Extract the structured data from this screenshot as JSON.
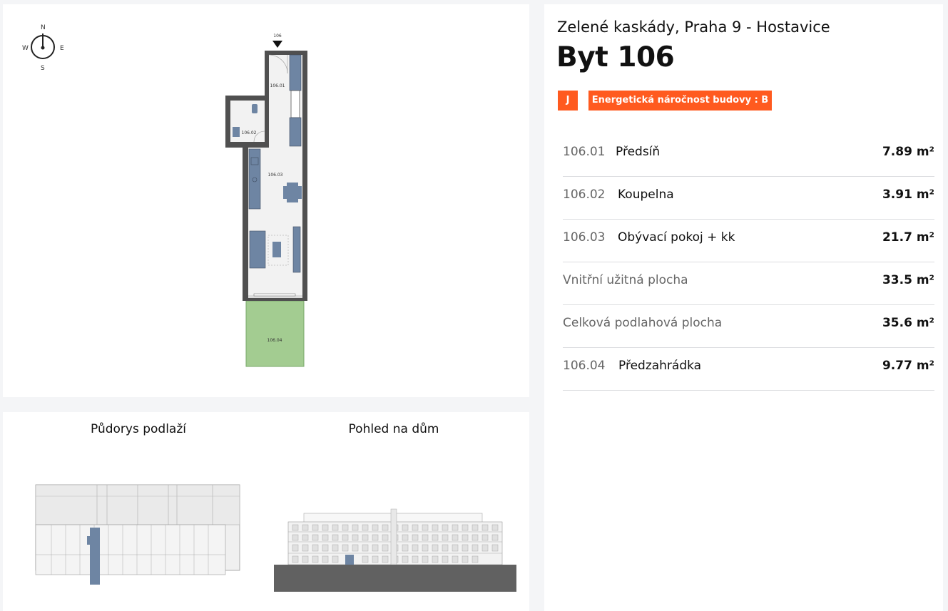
{
  "floorplan": {
    "compass": {
      "n": "N",
      "s": "S",
      "w": "W",
      "e": "E"
    },
    "entrance_label": "106",
    "room_labels": {
      "r1": "106.01",
      "r2": "106.02",
      "r3": "106.03",
      "r4": "106.04"
    },
    "colors": {
      "wall": "#505050",
      "furniture": "#6e85a3",
      "garden": "#a3cc91"
    }
  },
  "thumbnails": {
    "floor_plan_title": "Půdorys podlaží",
    "house_view_title": "Pohled na dům"
  },
  "info": {
    "subtitle": "Zelené kaskády, Praha 9 - Hostavice",
    "title": "Byt 106",
    "badge_j": "J",
    "badge_energy": "Energetická náročnost budovy : B",
    "accent": "#ff5a1f",
    "rows": [
      {
        "code": "106.01",
        "name": "Předsíň",
        "value": "7.89 m²"
      },
      {
        "code": "106.02",
        "name": "Koupelna",
        "value": "3.91 m²"
      },
      {
        "code": "106.03",
        "name": "Obývací pokoj + kk",
        "value": "21.7 m²"
      },
      {
        "label": "Vnitřní užitná plocha",
        "value": "33.5 m²"
      },
      {
        "label": "Celková podlahová plocha",
        "value": "35.6 m²"
      },
      {
        "code": "106.04",
        "name": "Předzahrádka",
        "value": "9.77 m²"
      }
    ]
  }
}
